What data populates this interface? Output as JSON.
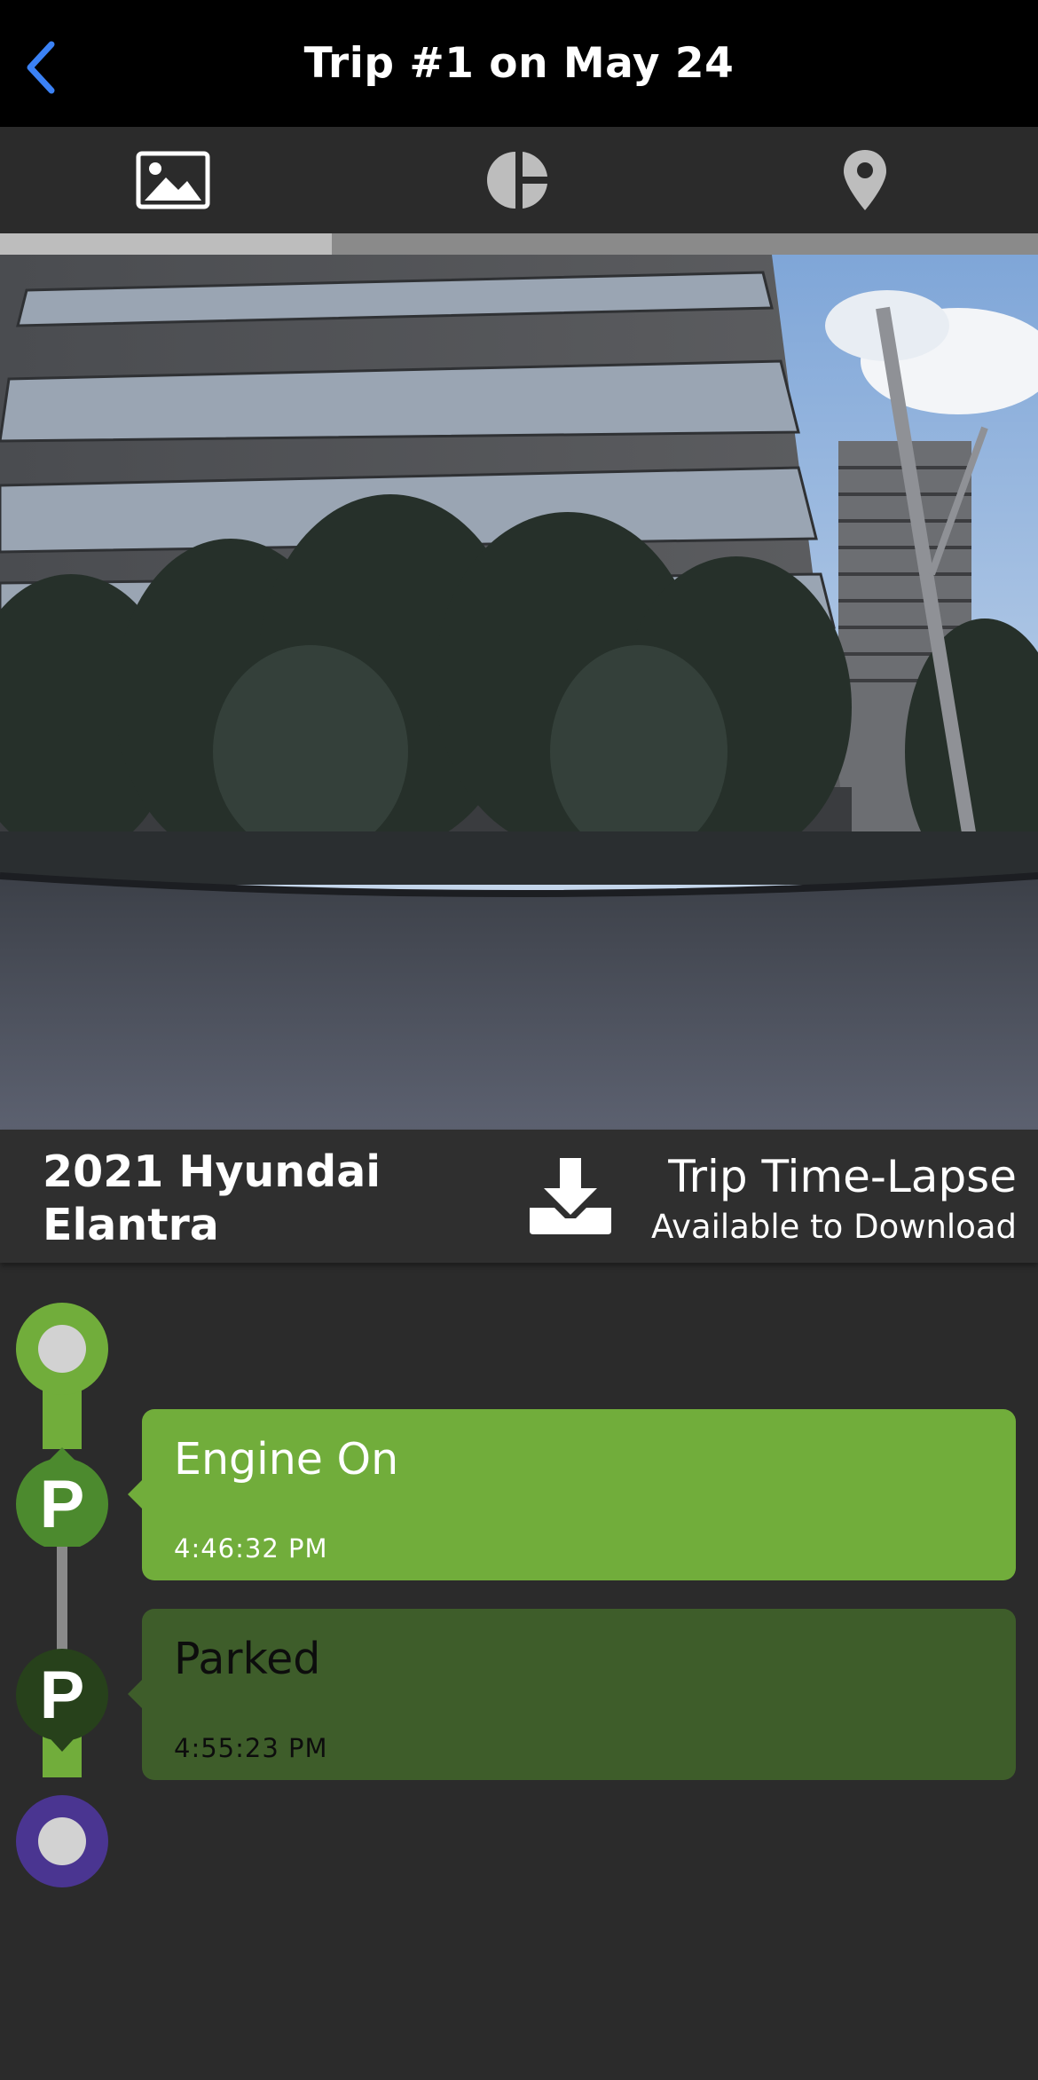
{
  "nav": {
    "title": "Trip #1 on May 24",
    "back_icon": "chevron-left-icon"
  },
  "tabs": [
    {
      "name": "photo",
      "icon": "image-icon",
      "active": true
    },
    {
      "name": "stats",
      "icon": "pie-chart-icon",
      "active": false
    },
    {
      "name": "map",
      "icon": "map-pin-icon",
      "active": false
    }
  ],
  "photo_progress": 0.32,
  "vehicle": {
    "line1": "2021 Hyundai",
    "line2": "Elantra"
  },
  "download": {
    "title": "Trip Time-Lapse",
    "subtitle": "Available to Download",
    "icon": "download-icon"
  },
  "timeline": {
    "events": [
      {
        "title": "Engine On",
        "time": "4:46:32 PM",
        "color": "#71ad3b"
      },
      {
        "title": "Parked",
        "time": "4:55:23 PM",
        "color": "#3e5d2a"
      }
    ]
  },
  "colors": {
    "accent_blue": "#3b82f6",
    "green": "#71ad3b",
    "dark_green": "#3e5d2a",
    "purple": "#4a3591",
    "background": "#2b2b2b"
  }
}
